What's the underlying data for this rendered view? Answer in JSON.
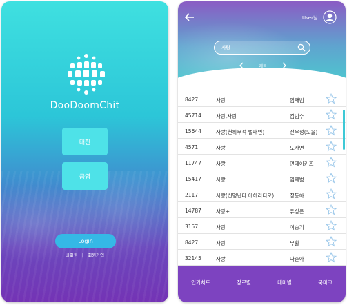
{
  "login_screen": {
    "logo_text": "DooDoomChit",
    "buttons": [
      "태진",
      "금영"
    ],
    "login_label": "Login",
    "links": [
      "비회원",
      "|",
      "회원가입"
    ]
  },
  "list_screen": {
    "user_label": "User님",
    "search_value": "사랑",
    "filter_label": "제목",
    "songs": [
      {
        "num": "8427",
        "title": "사랑",
        "artist": "임재범"
      },
      {
        "num": "45714",
        "title": "사랑,사랑",
        "artist": "김범수"
      },
      {
        "num": "15644",
        "title": "사랑(천하무적 벌패연)",
        "artist": "전우성(노을)"
      },
      {
        "num": "4571",
        "title": "사랑",
        "artist": "노사연"
      },
      {
        "num": "11747",
        "title": "사랑",
        "artist": "먼데이키즈"
      },
      {
        "num": "15417",
        "title": "사랑",
        "artist": "임재범"
      },
      {
        "num": "2117",
        "title": "사랑(신명난다 에헤라디오)",
        "artist": "정동하"
      },
      {
        "num": "14787",
        "title": "사랑+",
        "artist": "유성은"
      },
      {
        "num": "3157",
        "title": "사랑",
        "artist": "이승기"
      },
      {
        "num": "8427",
        "title": "사랑",
        "artist": "부활"
      },
      {
        "num": "32145",
        "title": "사랑",
        "artist": "나훈아"
      }
    ],
    "nav_items": [
      "인기차트",
      "장르별",
      "테마별",
      "북마크"
    ]
  },
  "icons": {
    "back": "back-arrow-icon",
    "user": "user-avatar-icon",
    "search": "search-icon",
    "star": "star-outline-icon",
    "logo": "disco-ball-icon"
  },
  "colors": {
    "accent_cyan": "#4ee2e8",
    "login_blue": "#35b8e6",
    "nav_purple": "#7d43c0",
    "star_blue": "#9cc8ea"
  }
}
